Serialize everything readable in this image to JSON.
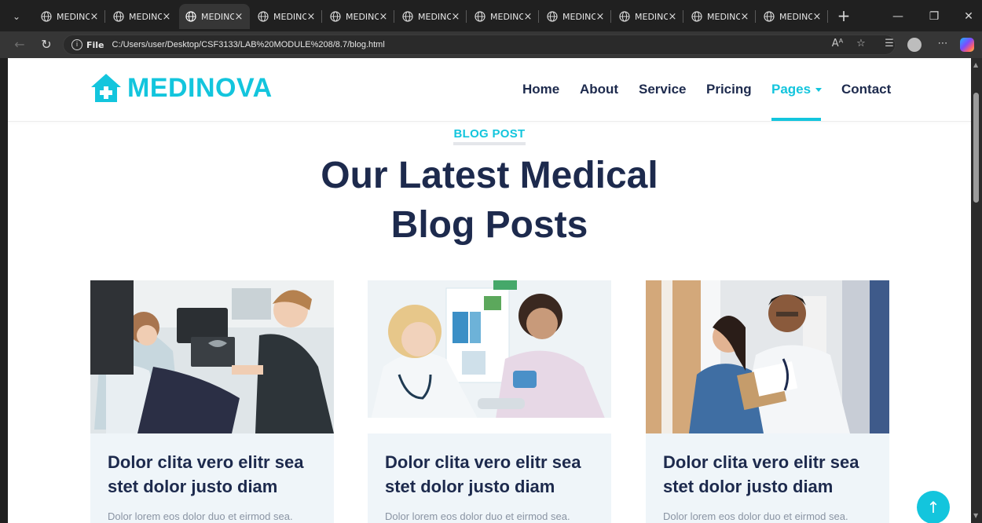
{
  "browser": {
    "tabs": [
      {
        "label": "MEDINOVA",
        "close": "×",
        "active": false
      },
      {
        "label": "MEDINOVA",
        "close": "×",
        "active": false
      },
      {
        "label": "MEDINOVA",
        "close": "×",
        "active": true
      },
      {
        "label": "MEDINOVA",
        "close": "×",
        "active": false
      },
      {
        "label": "MEDINOVA",
        "close": "×",
        "active": false
      },
      {
        "label": "MEDINOVA",
        "close": "×",
        "active": false
      },
      {
        "label": "MEDINOVA",
        "close": "×",
        "active": false
      },
      {
        "label": "MEDINOVA",
        "close": "×",
        "active": false
      },
      {
        "label": "MEDINOVA",
        "close": "×",
        "active": false
      },
      {
        "label": "MEDINOVA",
        "close": "×",
        "active": false
      },
      {
        "label": "MEDINOVA",
        "close": "×",
        "active": false
      }
    ],
    "new_tab": "+",
    "address": {
      "scheme_label": "File",
      "url": "C:/Users/user/Desktop/CSF3133/LAB%20MODULE%208/8.7/blog.html"
    }
  },
  "site": {
    "brand": "MEDINOVA",
    "brand_color": "#13C5DD",
    "heading_color": "#1D2A4D",
    "nav": {
      "home": "Home",
      "about": "About",
      "service": "Service",
      "pricing": "Pricing",
      "pages": "Pages",
      "contact": "Contact",
      "active": "Pages"
    },
    "section_tag": "BLOG POST",
    "headline": "Our Latest Medical Blog Posts",
    "cards": [
      {
        "title": "Dolor clita vero elitr sea stet dolor justo diam",
        "excerpt": "Dolor lorem eos dolor duo et eirmod sea.",
        "image": "dentist-x-ray-photo"
      },
      {
        "title": "Dolor clita vero elitr sea stet dolor justo diam",
        "excerpt": "Dolor lorem eos dolor duo et eirmod sea.",
        "image": "doctor-blood-pressure-photo"
      },
      {
        "title": "Dolor clita vero elitr sea stet dolor justo diam",
        "excerpt": "Dolor lorem eos dolor duo et eirmod sea.",
        "image": "doctors-reviewing-chart-photo"
      }
    ],
    "back_to_top": "↑"
  }
}
